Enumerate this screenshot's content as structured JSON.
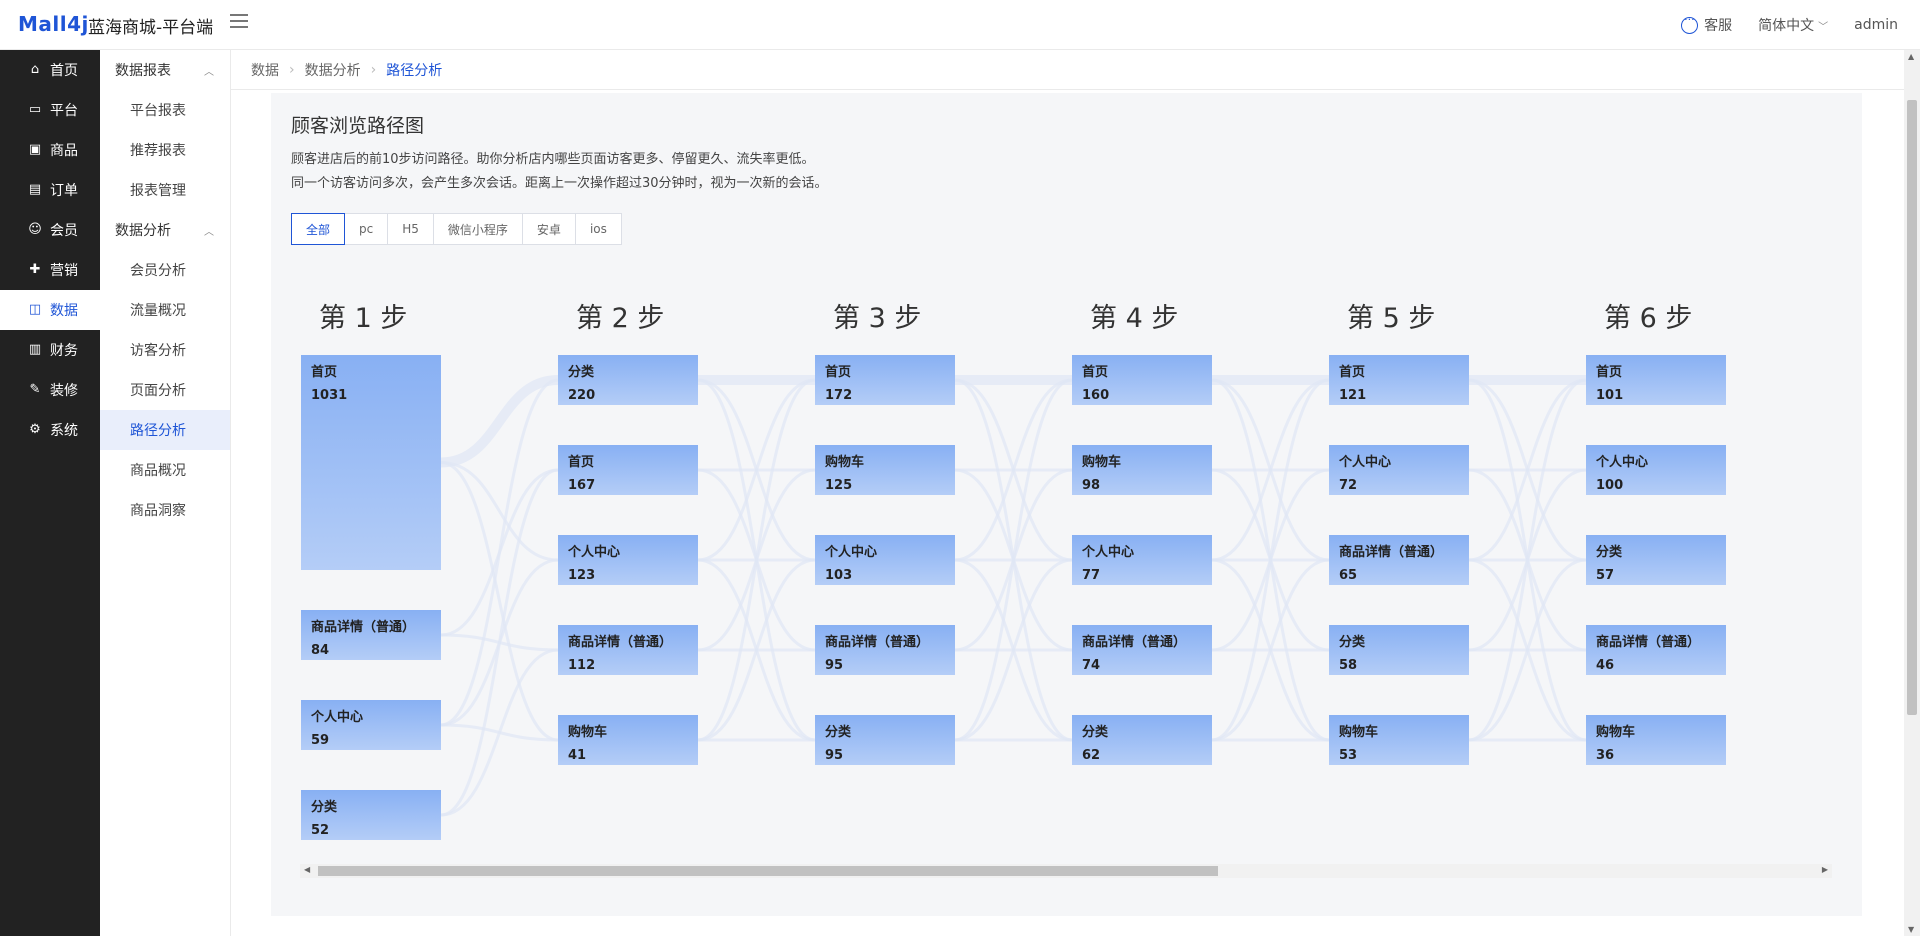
{
  "header": {
    "logo": "Mall4j",
    "title": "蓝海商城-平台端",
    "service": "客服",
    "language": "简体中文",
    "user": "admin"
  },
  "sidebar": {
    "items": [
      {
        "label": "首页",
        "icon": "home-icon"
      },
      {
        "label": "平台",
        "icon": "monitor-icon"
      },
      {
        "label": "商品",
        "icon": "bag-icon"
      },
      {
        "label": "订单",
        "icon": "document-icon"
      },
      {
        "label": "会员",
        "icon": "users-icon"
      },
      {
        "label": "营销",
        "icon": "gift-icon"
      },
      {
        "label": "数据",
        "icon": "chart-icon"
      },
      {
        "label": "财务",
        "icon": "wallet-icon"
      },
      {
        "label": "装修",
        "icon": "tools-icon"
      },
      {
        "label": "系统",
        "icon": "gear-icon"
      }
    ],
    "active": "数据"
  },
  "submenu": {
    "group1": "数据报表",
    "group1_items": [
      "平台报表",
      "推荐报表",
      "报表管理"
    ],
    "group2": "数据分析",
    "group2_items": [
      "会员分析",
      "流量概况",
      "访客分析",
      "页面分析",
      "路径分析",
      "商品概况",
      "商品洞察"
    ],
    "active": "路径分析"
  },
  "breadcrumb": [
    "数据",
    "数据分析",
    "路径分析"
  ],
  "panel": {
    "title": "顾客浏览路径图",
    "desc1": "顾客进店后的前10步访问路径。助你分析店内哪些页面访客更多、停留更久、流失率更低。",
    "desc2": "同一个访客访问多次，会产生多次会话。距离上一次操作超过30分钟时，视为一次新的会话。",
    "tabs": [
      "全部",
      "pc",
      "H5",
      "微信小程序",
      "安卓",
      "ios"
    ],
    "active_tab": "全部"
  },
  "chart_data": {
    "type": "sankey",
    "steps": [
      {
        "title": "第 1 步",
        "nodes": [
          {
            "name": "首页",
            "value": 1031
          },
          {
            "name": "商品详情（普通）",
            "value": 84
          },
          {
            "name": "个人中心",
            "value": 59
          },
          {
            "name": "分类",
            "value": 52
          }
        ]
      },
      {
        "title": "第 2 步",
        "nodes": [
          {
            "name": "分类",
            "value": 220
          },
          {
            "name": "首页",
            "value": 167
          },
          {
            "name": "个人中心",
            "value": 123
          },
          {
            "name": "商品详情（普通）",
            "value": 112
          },
          {
            "name": "购物车",
            "value": 41
          }
        ]
      },
      {
        "title": "第 3 步",
        "nodes": [
          {
            "name": "首页",
            "value": 172
          },
          {
            "name": "购物车",
            "value": 125
          },
          {
            "name": "个人中心",
            "value": 103
          },
          {
            "name": "商品详情（普通）",
            "value": 95
          },
          {
            "name": "分类",
            "value": 95
          }
        ]
      },
      {
        "title": "第 4 步",
        "nodes": [
          {
            "name": "首页",
            "value": 160
          },
          {
            "name": "购物车",
            "value": 98
          },
          {
            "name": "个人中心",
            "value": 77
          },
          {
            "name": "商品详情（普通）",
            "value": 74
          },
          {
            "name": "分类",
            "value": 62
          }
        ]
      },
      {
        "title": "第 5 步",
        "nodes": [
          {
            "name": "首页",
            "value": 121
          },
          {
            "name": "个人中心",
            "value": 72
          },
          {
            "name": "商品详情（普通）",
            "value": 65
          },
          {
            "name": "分类",
            "value": 58
          },
          {
            "name": "购物车",
            "value": 53
          }
        ]
      },
      {
        "title": "第 6 步",
        "nodes": [
          {
            "name": "首页",
            "value": 101
          },
          {
            "name": "个人中心",
            "value": 100
          },
          {
            "name": "分类",
            "value": 57
          },
          {
            "name": "商品详情（普通）",
            "value": 46
          },
          {
            "name": "购物车",
            "value": 36
          }
        ]
      }
    ]
  }
}
